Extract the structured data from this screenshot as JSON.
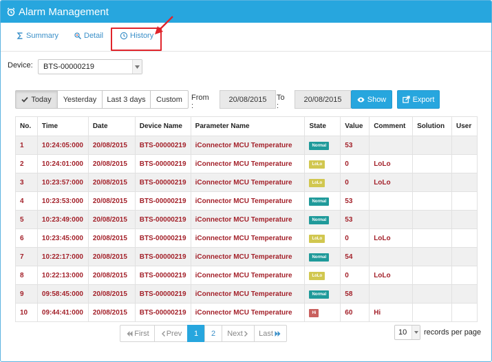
{
  "header": {
    "title": "Alarm Management",
    "icon": "alarm-clock-icon"
  },
  "tabs": [
    {
      "label": "Summary",
      "icon": "sigma-icon"
    },
    {
      "label": "Detail",
      "icon": "pin-icon"
    },
    {
      "label": "History",
      "icon": "clock-icon",
      "active": true
    }
  ],
  "device": {
    "label": "Device:",
    "value": "BTS-00000219"
  },
  "filters": {
    "ranges": [
      "Today",
      "Yesterday",
      "Last 3 days",
      "Custom"
    ],
    "active_range": "Today",
    "from_label": "From :",
    "from_value": "20/08/2015",
    "to_label": "To :",
    "to_value": "20/08/2015",
    "show_label": "Show",
    "export_label": "Export"
  },
  "table": {
    "columns": [
      "No.",
      "Time",
      "Date",
      "Device Name",
      "Parameter Name",
      "State",
      "Value",
      "Comment",
      "Solution",
      "User"
    ],
    "rows": [
      {
        "no": "1",
        "time": "10:24:05:000",
        "date": "20/08/2015",
        "device": "BTS-00000219",
        "param": "iConnector MCU Temperature",
        "state": "Normal",
        "value": "53",
        "comment": "",
        "solution": "",
        "user": ""
      },
      {
        "no": "2",
        "time": "10:24:01:000",
        "date": "20/08/2015",
        "device": "BTS-00000219",
        "param": "iConnector MCU Temperature",
        "state": "LoLo",
        "value": "0",
        "comment": "LoLo",
        "solution": "",
        "user": ""
      },
      {
        "no": "3",
        "time": "10:23:57:000",
        "date": "20/08/2015",
        "device": "BTS-00000219",
        "param": "iConnector MCU Temperature",
        "state": "LoLo",
        "value": "0",
        "comment": "LoLo",
        "solution": "",
        "user": ""
      },
      {
        "no": "4",
        "time": "10:23:53:000",
        "date": "20/08/2015",
        "device": "BTS-00000219",
        "param": "iConnector MCU Temperature",
        "state": "Normal",
        "value": "53",
        "comment": "",
        "solution": "",
        "user": ""
      },
      {
        "no": "5",
        "time": "10:23:49:000",
        "date": "20/08/2015",
        "device": "BTS-00000219",
        "param": "iConnector MCU Temperature",
        "state": "Normal",
        "value": "53",
        "comment": "",
        "solution": "",
        "user": ""
      },
      {
        "no": "6",
        "time": "10:23:45:000",
        "date": "20/08/2015",
        "device": "BTS-00000219",
        "param": "iConnector MCU Temperature",
        "state": "LoLo",
        "value": "0",
        "comment": "LoLo",
        "solution": "",
        "user": ""
      },
      {
        "no": "7",
        "time": "10:22:17:000",
        "date": "20/08/2015",
        "device": "BTS-00000219",
        "param": "iConnector MCU Temperature",
        "state": "Normal",
        "value": "54",
        "comment": "",
        "solution": "",
        "user": ""
      },
      {
        "no": "8",
        "time": "10:22:13:000",
        "date": "20/08/2015",
        "device": "BTS-00000219",
        "param": "iConnector MCU Temperature",
        "state": "LoLo",
        "value": "0",
        "comment": "LoLo",
        "solution": "",
        "user": ""
      },
      {
        "no": "9",
        "time": "09:58:45:000",
        "date": "20/08/2015",
        "device": "BTS-00000219",
        "param": "iConnector MCU Temperature",
        "state": "Normal",
        "value": "58",
        "comment": "",
        "solution": "",
        "user": ""
      },
      {
        "no": "10",
        "time": "09:44:41:000",
        "date": "20/08/2015",
        "device": "BTS-00000219",
        "param": "iConnector MCU Temperature",
        "state": "Hi",
        "value": "60",
        "comment": "Hi",
        "solution": "",
        "user": ""
      }
    ]
  },
  "state_colors": {
    "Normal": "#1f9a9a",
    "LoLo": "#d1c74f",
    "Hi": "#c9605e"
  },
  "pagination": {
    "first": "First",
    "prev": "Prev",
    "next": "Next",
    "last": "Last",
    "pages": [
      "1",
      "2"
    ],
    "current": "1"
  },
  "per_page": {
    "value": "10",
    "label": "records per page"
  },
  "colors": {
    "accent": "#27a6de",
    "text_red": "#a3212a",
    "highlight_red": "#e0242b"
  }
}
